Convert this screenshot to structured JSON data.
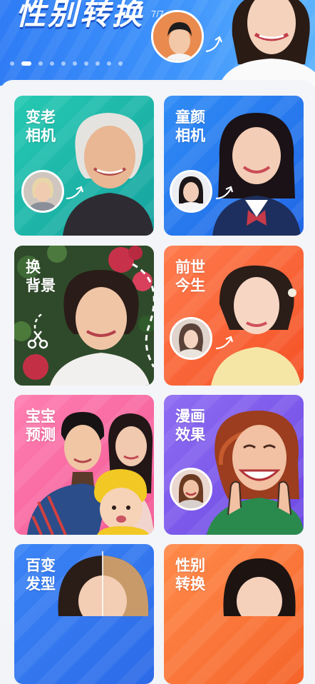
{
  "banner": {
    "title": "性别转换",
    "counter": "7/7",
    "dots": 10,
    "active_dot": 1
  },
  "features": [
    {
      "title": "变老\n相机",
      "color": "#1fb5a9"
    },
    {
      "title": "童颜\n相机",
      "color": "#2a7bef"
    },
    {
      "title": "换\n背景",
      "color": "#3c5533"
    },
    {
      "title": "前世\n今生",
      "color": "#f76637"
    },
    {
      "title": "宝宝\n预测",
      "color": "#f66ba3"
    },
    {
      "title": "漫画\n效果",
      "color": "#7e5aea"
    },
    {
      "title": "百变\n发型",
      "color": "#3478ef"
    },
    {
      "title": "性别\n转换",
      "color": "#f87638"
    }
  ]
}
